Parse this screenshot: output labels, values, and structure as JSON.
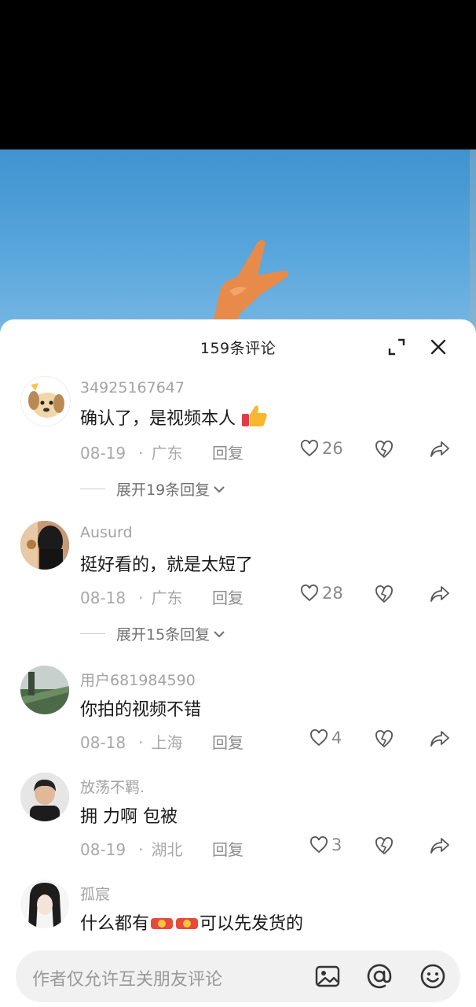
{
  "header": {
    "title": "159条评论"
  },
  "comments": [
    {
      "username": "34925167647",
      "text": "确认了，是视频本人",
      "date": "08-19",
      "location": "广东",
      "reply_label": "回复",
      "likes": "26",
      "expand_label": "展开19条回复"
    },
    {
      "username": "Ausurd",
      "text": "挺好看的，就是太短了",
      "date": "08-18",
      "location": "广东",
      "reply_label": "回复",
      "likes": "28",
      "expand_label": "展开15条回复"
    },
    {
      "username": "用户681984590",
      "text": "你拍的视频不错",
      "date": "08-18",
      "location": "上海",
      "reply_label": "回复",
      "likes": "4"
    },
    {
      "username": "放荡不羁.",
      "text": "拥 力啊 包被",
      "date": "08-19",
      "location": "湖北",
      "reply_label": "回复",
      "likes": "3"
    },
    {
      "username": "孤宸",
      "text_before": "什么都有",
      "text_after": "可以先发货的"
    }
  ],
  "input": {
    "placeholder": "作者仅允许互关朋友评论"
  },
  "colors": {
    "sky": "#4a9bd6",
    "sheet_bg": "#ffffff",
    "secondary_text": "#a3a3a3",
    "input_bg": "#f1f1f1"
  },
  "icons": [
    "expand-icon",
    "close-icon",
    "heart-icon",
    "broken-heart-icon",
    "share-arrow-icon",
    "chevron-down-icon",
    "image-icon",
    "at-icon",
    "emoji-icon",
    "thumbs-up-emoji"
  ]
}
